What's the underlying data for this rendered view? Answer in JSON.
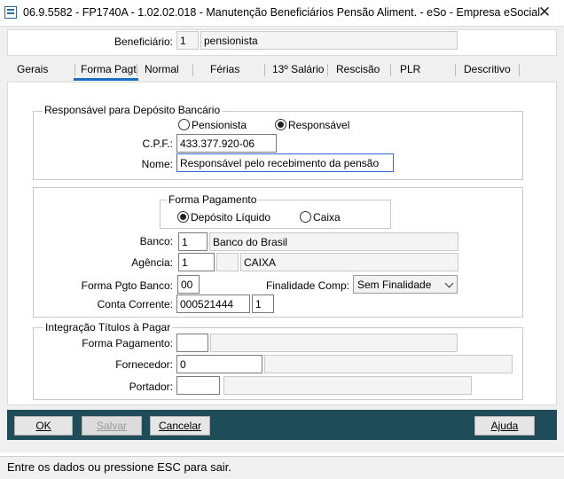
{
  "window": {
    "title": "06.9.5582 - FP1740A - 1.02.02.018 - Manutenção Beneficiários Pensão Aliment. - eSo - Empresa eSocial",
    "close": "✕"
  },
  "header": {
    "beneficiario_label": "Beneficiário:",
    "beneficiario_code": "1",
    "beneficiario_name": "pensionista"
  },
  "tabs": [
    "Gerais",
    "Forma Pagt",
    "Normal",
    "Férias",
    "13º Salário",
    "Rescisão",
    "PLR",
    "Descritivo"
  ],
  "responsavel": {
    "group_title": "Responsável para Depósito Bancário",
    "radio_pensionista": "Pensionista",
    "radio_responsavel": "Responsável",
    "cpf_label": "C.P.F.:",
    "cpf_value": "433.377.920-06",
    "nome_label": "Nome:",
    "nome_value": "Responsável pelo recebimento da pensão"
  },
  "pagamento": {
    "forma_title": "Forma Pagamento",
    "radio_deposito": "Depósito Líquido",
    "radio_caixa": "Caixa",
    "banco_label": "Banco:",
    "banco_code": "1",
    "banco_name": "Banco do Brasil",
    "agencia_label": "Agência:",
    "agencia_code": "1",
    "agencia_digit": "",
    "agencia_name": "CAIXA",
    "forma_pgto_banco_label": "Forma Pgto Banco:",
    "forma_pgto_banco_value": "00",
    "finalidade_label": "Finalidade Comp:",
    "finalidade_value": "Sem Finalidade",
    "conta_label": "Conta Corrente:",
    "conta_value": "000521444",
    "conta_digit": "1"
  },
  "integracao": {
    "group_title": "Integração Títulos à Pagar",
    "forma_label": "Forma Pagamento:",
    "forma_code": "",
    "forma_desc": "",
    "fornecedor_label": "Fornecedor:",
    "fornecedor_code": "0",
    "fornecedor_desc": "",
    "portador_label": "Portador:",
    "portador_code": "",
    "portador_desc": ""
  },
  "buttons": {
    "ok": "OK",
    "salvar": "Salvar",
    "cancelar": "Cancelar",
    "ajuda": "Ajuda"
  },
  "status": "Entre os dados ou pressione ESC para sair."
}
